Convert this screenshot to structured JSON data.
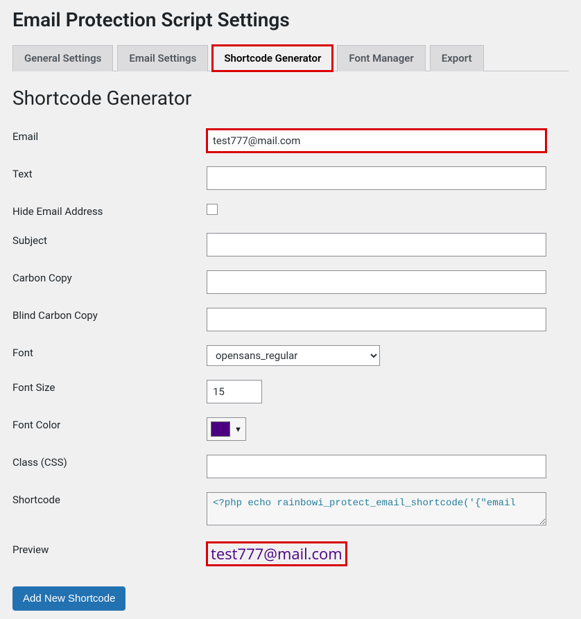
{
  "page": {
    "title": "Email Protection Script Settings",
    "section_title": "Shortcode Generator"
  },
  "tabs": [
    {
      "label": "General Settings",
      "active": false
    },
    {
      "label": "Email Settings",
      "active": false
    },
    {
      "label": "Shortcode Generator",
      "active": true,
      "highlight": true
    },
    {
      "label": "Font Manager",
      "active": false
    },
    {
      "label": "Export",
      "active": false
    }
  ],
  "form": {
    "email_label": "Email",
    "email_value": "test777@mail.com",
    "text_label": "Text",
    "text_value": "",
    "hide_label": "Hide Email Address",
    "subject_label": "Subject",
    "subject_value": "",
    "cc_label": "Carbon Copy",
    "cc_value": "",
    "bcc_label": "Blind Carbon Copy",
    "bcc_value": "",
    "font_label": "Font",
    "font_value": "opensans_regular",
    "fontsize_label": "Font Size",
    "fontsize_value": "15",
    "fontcolor_label": "Font Color",
    "fontcolor_value": "#4b0082",
    "class_label": "Class (CSS)",
    "class_value": "",
    "shortcode_label": "Shortcode",
    "shortcode_value": "<?php echo rainbowi_protect_email_shortcode('{\"email",
    "preview_label": "Preview",
    "preview_value": "test777@mail.com"
  },
  "button": {
    "add_label": "Add New Shortcode"
  }
}
